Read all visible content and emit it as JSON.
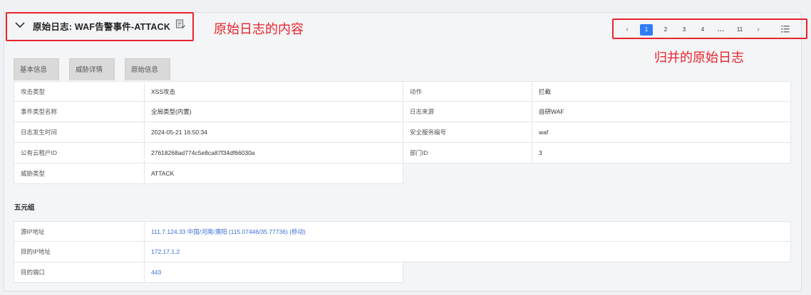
{
  "header": {
    "title": "原始日志: WAF告警事件-ATTACK"
  },
  "pagination": {
    "prev": "‹",
    "pages": [
      "1",
      "2",
      "3",
      "4"
    ],
    "ellipsis": "...",
    "last": "11",
    "next": "›",
    "active": "1"
  },
  "annotations": {
    "content_label": "原始日志的内容",
    "merged_label": "归并的原始日志"
  },
  "tabs": [
    {
      "label": "基本信息"
    },
    {
      "label": "威胁详情"
    },
    {
      "label": "原始信息"
    }
  ],
  "basic_info": {
    "rows": [
      {
        "l1": "攻击类型",
        "v1": "XSS攻击",
        "l2": "动作",
        "v2": "拦截"
      },
      {
        "l1": "事件类型名称",
        "v1": "全局类型(内置)",
        "l2": "日志来源",
        "v2": "自研WAF"
      },
      {
        "l1": "日志发生时间",
        "v1": "2024-05-21 16:50:34",
        "l2": "安全服务编号",
        "v2": "waf"
      },
      {
        "l1": "公有云租户ID",
        "v1": "27618268ad774c5e8ca87f34df66030a",
        "l2": "部门ID",
        "v2": "3"
      },
      {
        "l1": "威胁类型",
        "v1": "ATTACK"
      }
    ]
  },
  "five_tuple": {
    "title": "五元组",
    "rows": [
      {
        "label": "源IP地址",
        "value": "111.7.124.33 中国/河南/濮阳 (115.07446/35.77736) (移动)"
      },
      {
        "label": "目的IP地址",
        "value": "172.17.1.2"
      },
      {
        "label": "目的端口",
        "value": "443"
      }
    ]
  },
  "colors": {
    "accent": "#2f7cf6",
    "annotation": "#e8232b",
    "link": "#3a6fd8"
  }
}
